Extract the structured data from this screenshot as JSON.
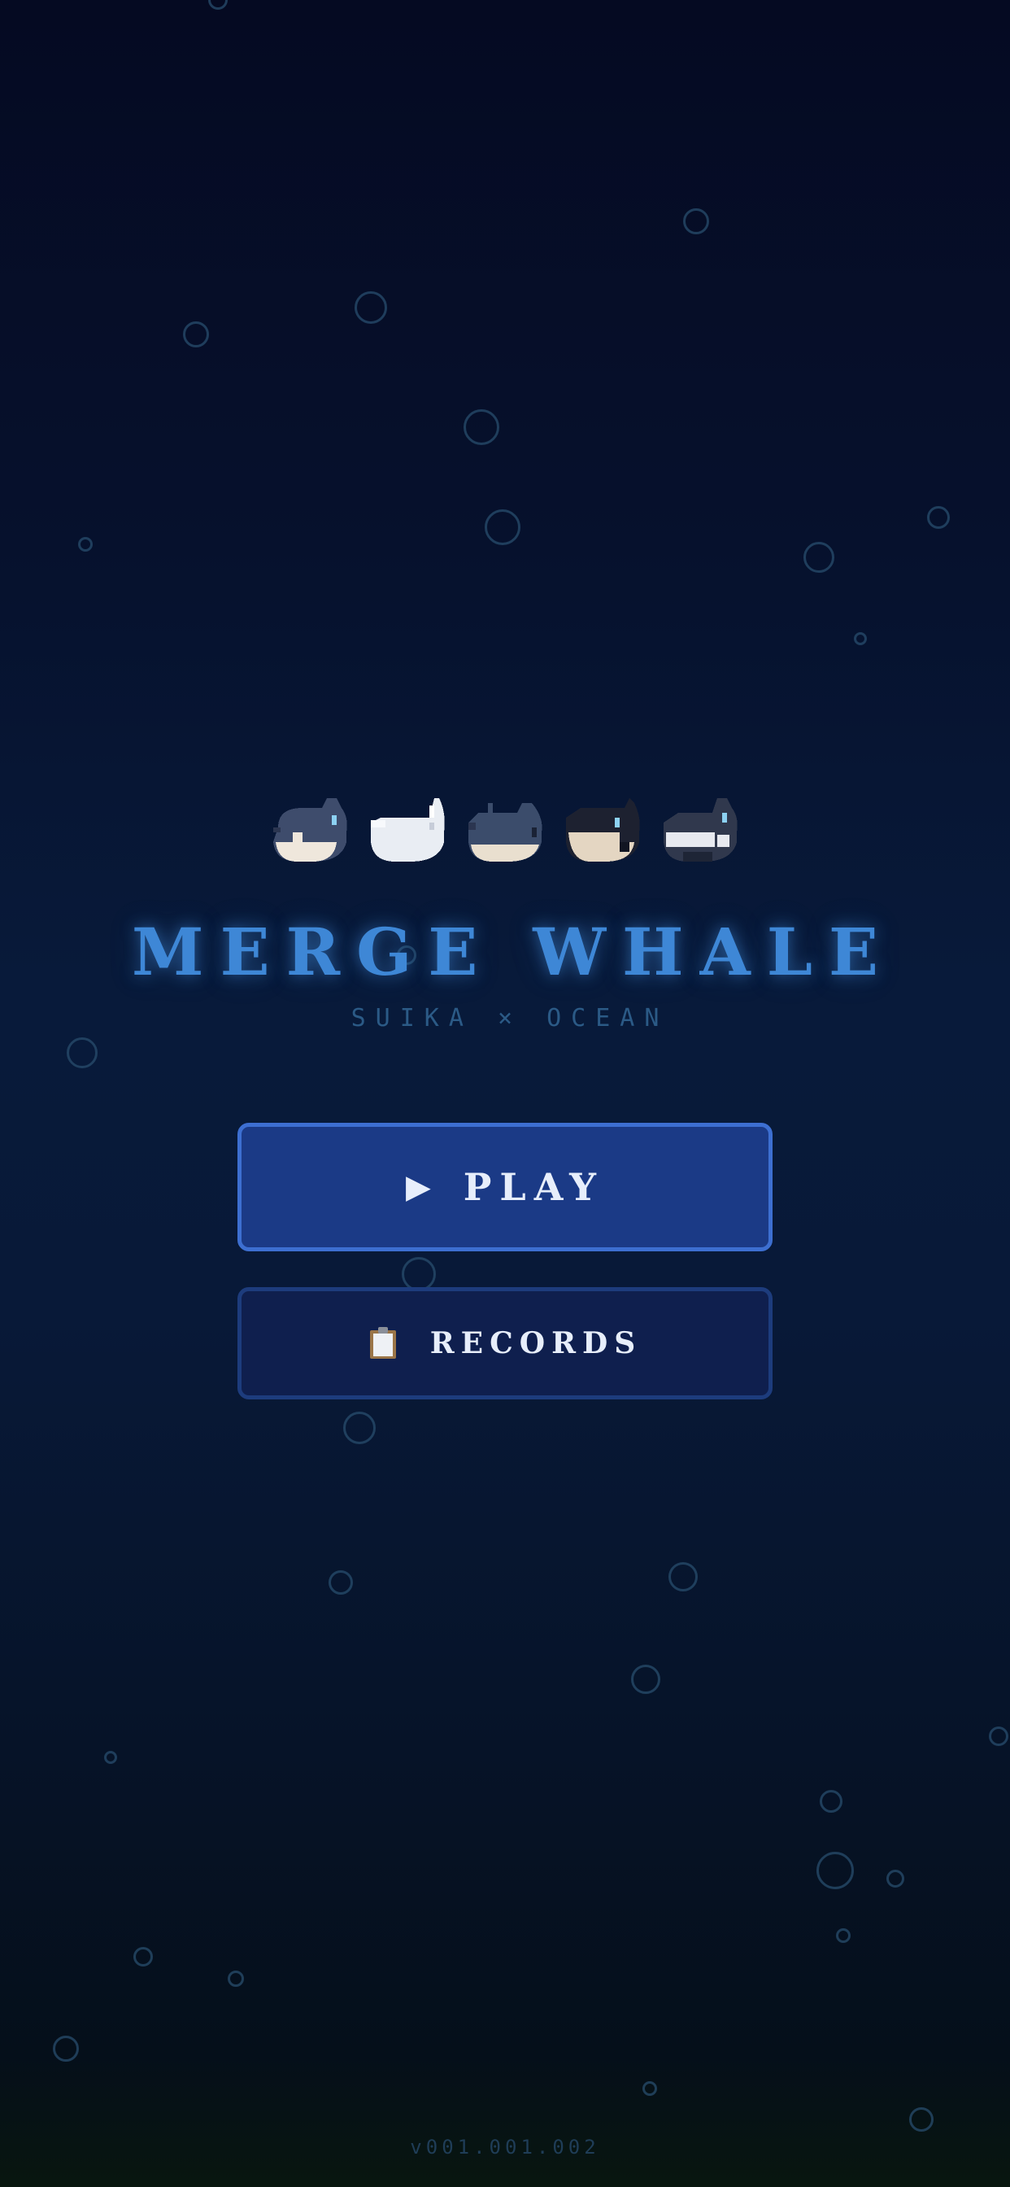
{
  "title": "MERGE WHALE",
  "subtitle": "SUIKA × OCEAN",
  "buttons": {
    "play_label": "PLAY",
    "play_icon": "play-triangle",
    "records_label": "RECORDS",
    "records_icon": "clipboard"
  },
  "whales": [
    "grey-whale",
    "white-beluga",
    "blue-whale",
    "black-whale",
    "orca"
  ],
  "version": "v001.001.002",
  "colors": {
    "accent": "#3e87d6",
    "play_button": "#1b3a86",
    "records_button": "#0f1f4e"
  }
}
